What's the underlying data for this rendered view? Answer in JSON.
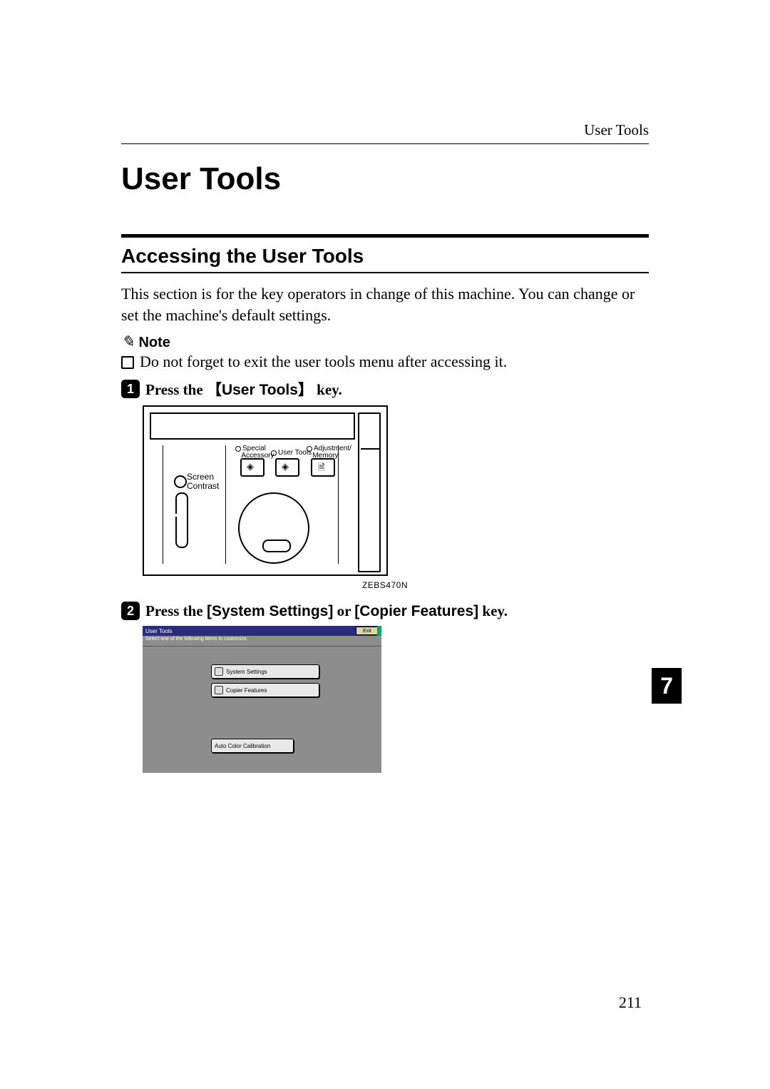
{
  "header": {
    "running": "User Tools"
  },
  "title": "User Tools",
  "section": "Accessing the User Tools",
  "intro": "This section is for the key operators in change of this machine. You can change or set the machine's default settings.",
  "note": {
    "label": "Note",
    "text": "Do not forget to exit the user tools menu after accessing it."
  },
  "steps": {
    "s1": {
      "num": "1",
      "pre": "Press the ",
      "keycap_open": "【",
      "keycap_label": "User Tools",
      "keycap_close": "】",
      "post": " key."
    },
    "s2": {
      "num": "2",
      "pre": "Press the ",
      "key1_open": "[",
      "key1_label": "System Settings",
      "key1_close": "]",
      "mid": " or ",
      "key2_open": "[",
      "key2_label": "Copier Features",
      "key2_close": "]",
      "post": " key."
    }
  },
  "panel": {
    "label_special": "Special",
    "label_accessory": "Accessory",
    "label_user_tools": "User Tools",
    "label_adjustment": "Adjustment/",
    "label_memory": "Memory",
    "label_screen": "Screen",
    "label_contrast": "Contrast",
    "diagram_tag": "ZEBS470N"
  },
  "screenshot": {
    "title": "User Tools",
    "exit": "Exit",
    "sub": "Select one of the following items to customize.",
    "system_settings": "System Settings",
    "copier_features": "Copier Features",
    "auto_color": "Auto Color Calibration"
  },
  "chapter_tab": "7",
  "page_number": "211"
}
